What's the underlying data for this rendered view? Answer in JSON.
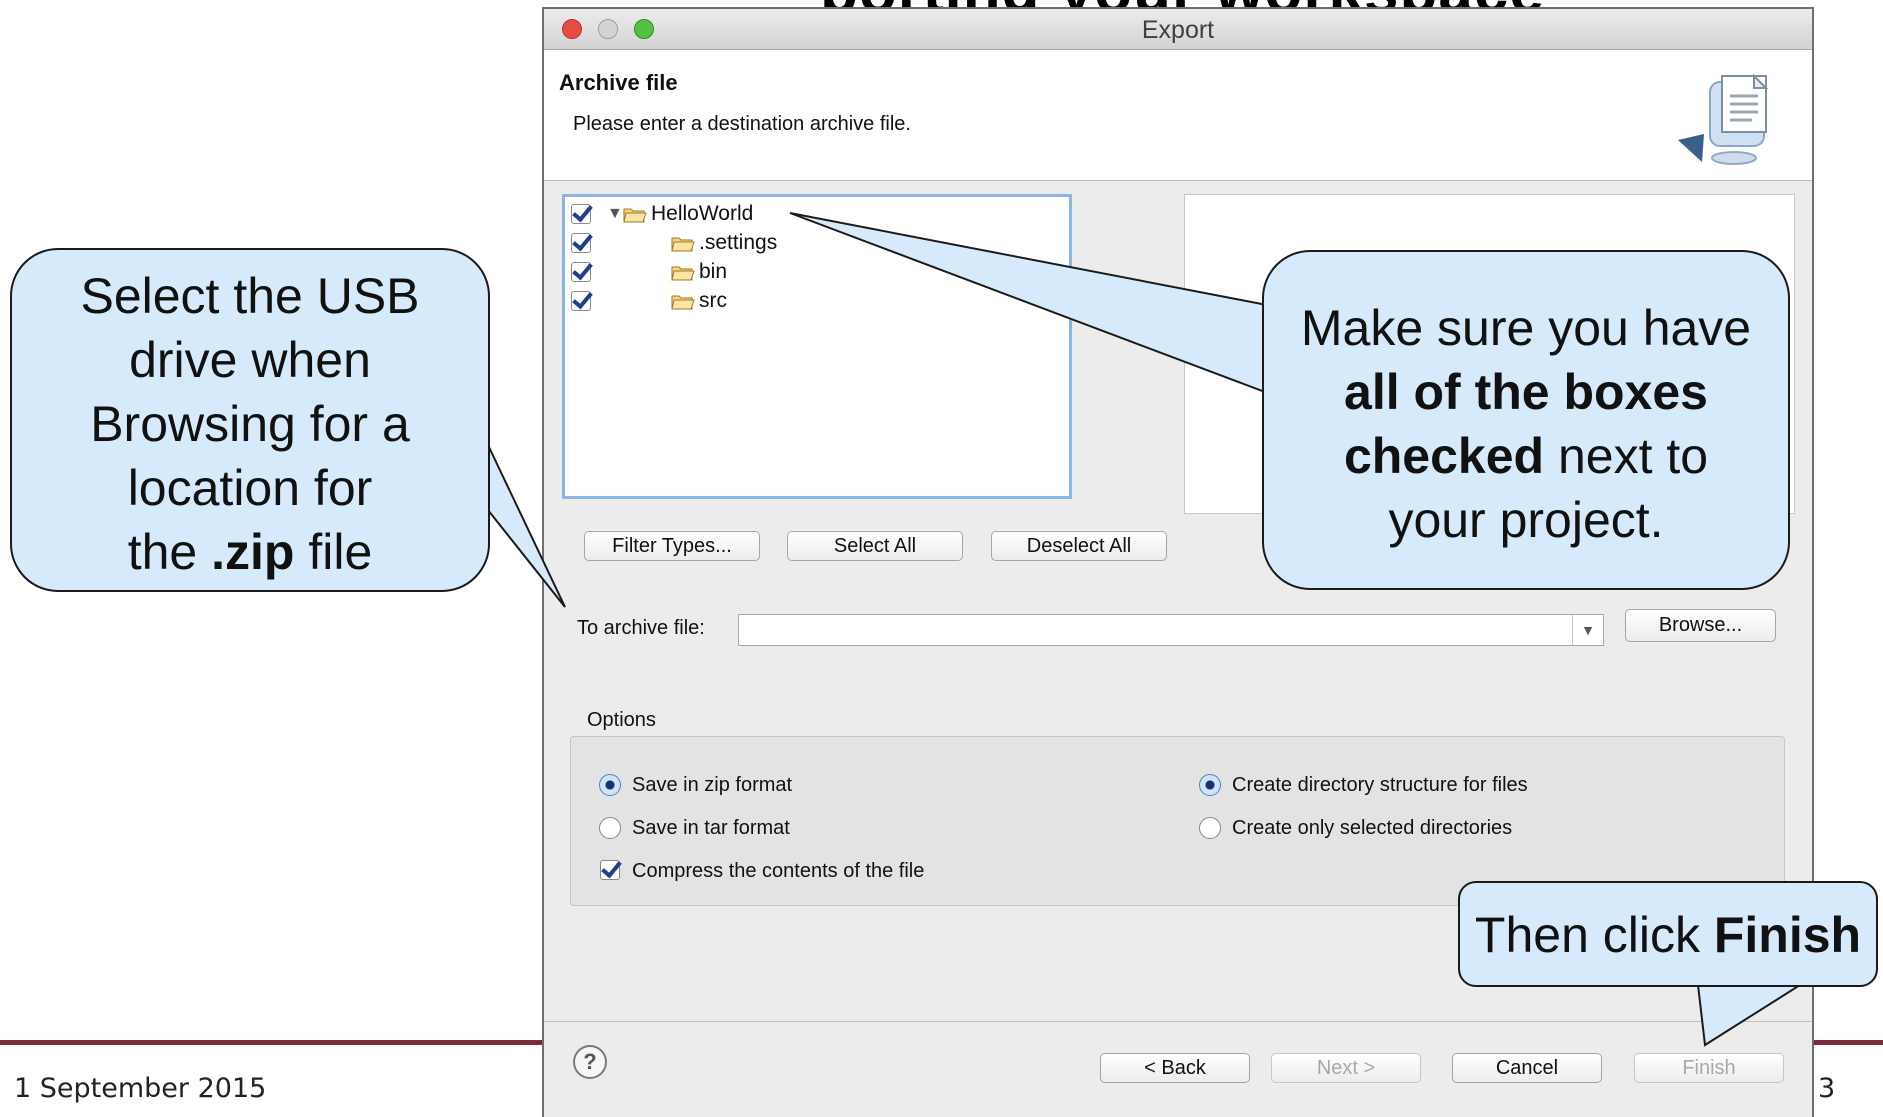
{
  "slide": {
    "title_fragment": "porting your workspace",
    "date": "1 September 2015",
    "page_number": "3"
  },
  "window": {
    "title": "Export",
    "header_title": "Archive file",
    "header_message": "Please enter a destination archive file."
  },
  "tree": {
    "items": [
      {
        "label": "HelloWorld",
        "checked": true
      },
      {
        "label": ".settings",
        "checked": true
      },
      {
        "label": "bin",
        "checked": true
      },
      {
        "label": "src",
        "checked": true
      }
    ]
  },
  "buttons": {
    "filter_types": "Filter Types...",
    "select_all": "Select All",
    "deselect_all": "Deselect All",
    "browse": "Browse...",
    "back": "< Back",
    "next": "Next >",
    "cancel": "Cancel",
    "finish": "Finish"
  },
  "archive": {
    "label": "To archive file:",
    "value": ""
  },
  "options": {
    "group_label": "Options",
    "zip": "Save in zip format",
    "tar": "Save in tar format",
    "compress": "Compress the contents of the file",
    "create_structure": "Create directory structure for files",
    "create_selected": "Create only selected directories"
  },
  "callouts": {
    "left_lines": [
      "Select the USB",
      "drive when",
      "Browsing for a",
      "location for"
    ],
    "left_last_pre": "the ",
    "left_last_bold": ".zip",
    "left_last_post": " file",
    "right_line1": "Make sure you have",
    "right_bold1": "all of the boxes",
    "right_bold2": "checked",
    "right_line3_post": " next to",
    "right_line4": "your project.",
    "finish_pre": "Then click ",
    "finish_bold": "Finish"
  },
  "colors": {
    "callout_fill": "#d7eafb",
    "slide_rule": "#7a2a3c",
    "tree_focus_border": "#8cb6e4"
  }
}
